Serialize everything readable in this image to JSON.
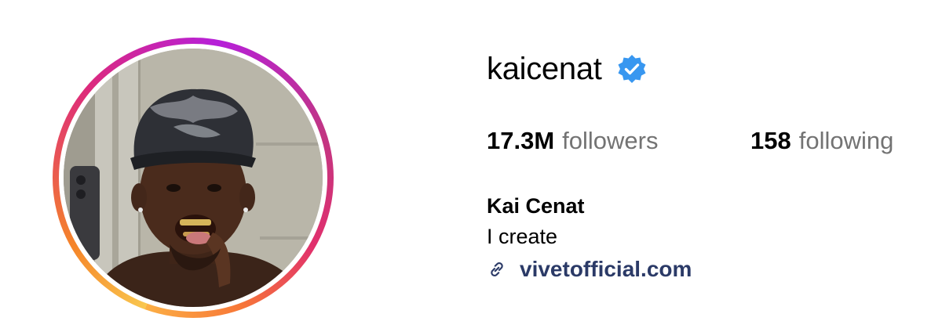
{
  "profile": {
    "username": "kaicenat",
    "verified": true,
    "full_name": "Kai Cenat",
    "bio": "I create",
    "link": {
      "text": "vivetofficial.com",
      "icon": "link-icon"
    },
    "avatar": {
      "icon": "profile-photo",
      "has_story_ring": true
    }
  },
  "stats": {
    "followers": {
      "count": "17.3M",
      "label": "followers"
    },
    "following": {
      "count": "158",
      "label": "following"
    }
  },
  "colors": {
    "verified_badge": "#3897f0",
    "link_text": "#2b3a67",
    "secondary_text": "#737373",
    "ring_gradient": [
      "#fcaf45",
      "#f58529",
      "#dd2a7b",
      "#b620d9",
      "#c13584"
    ]
  }
}
